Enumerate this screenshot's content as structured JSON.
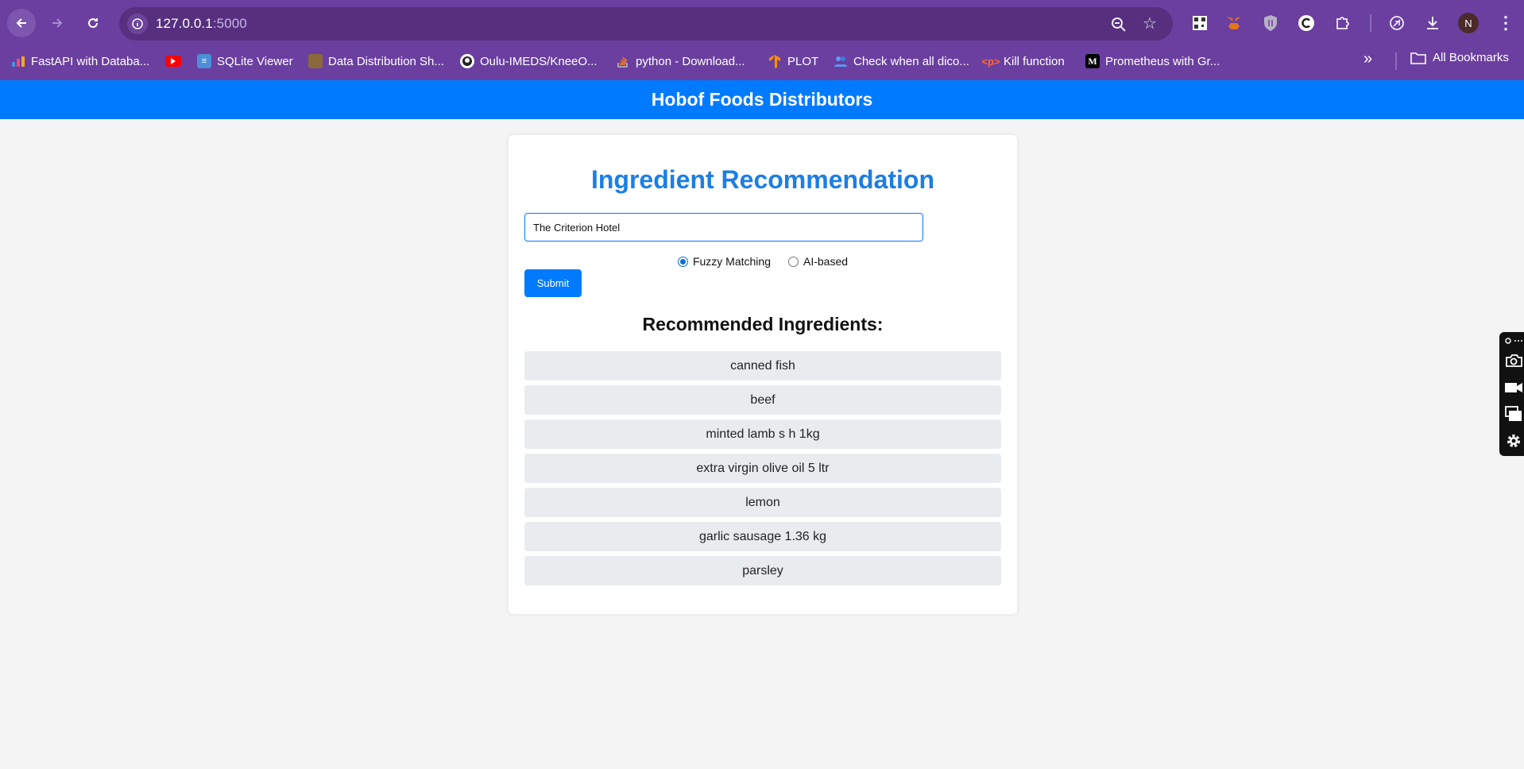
{
  "browser": {
    "url_host": "127.0.0.1",
    "url_port": ":5000",
    "avatar_initial": "N",
    "bookmarks": [
      {
        "label": "FastAPI with Databa...",
        "icon": "chart-icon"
      },
      {
        "label": "",
        "icon": "youtube-icon"
      },
      {
        "label": "SQLite Viewer",
        "icon": "database-icon"
      },
      {
        "label": "Data Distribution Sh...",
        "icon": "image-icon"
      },
      {
        "label": "Oulu-IMEDS/KneeO...",
        "icon": "github-icon"
      },
      {
        "label": "python - Download...",
        "icon": "stackoverflow-icon"
      },
      {
        "label": "PLOT",
        "icon": "tensorflow-icon"
      },
      {
        "label": "Check when all dico...",
        "icon": "people-icon"
      },
      {
        "label": "Kill function",
        "icon": "code-icon"
      },
      {
        "label": "Prometheus with Gr...",
        "icon": "medium-icon"
      }
    ],
    "all_bookmarks_label": "All Bookmarks"
  },
  "site": {
    "header_title": "Hobof Foods Distributors"
  },
  "form": {
    "title": "Ingredient Recommendation",
    "input_value": "The Criterion Hotel",
    "radio_options": [
      {
        "label": "Fuzzy Matching",
        "checked": true
      },
      {
        "label": "AI-based",
        "checked": false
      }
    ],
    "submit_label": "Submit"
  },
  "results": {
    "title": "Recommended Ingredients:",
    "items": [
      "canned fish",
      "beef",
      "minted lamb s h 1kg",
      "extra virgin olive oil 5 ltr",
      "lemon",
      "garlic sausage 1.36 kg",
      "parsley"
    ]
  },
  "colors": {
    "chrome": "#6a3fa0",
    "accent": "#007bff",
    "title_blue": "#1b7ee6",
    "item_bg": "#e9ecef"
  }
}
